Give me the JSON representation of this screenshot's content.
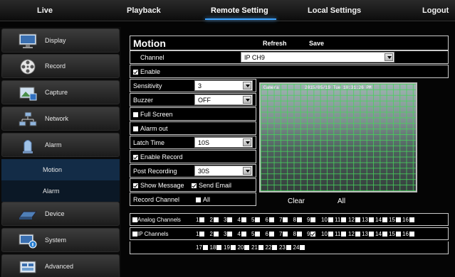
{
  "topnav": {
    "tabs": [
      {
        "label": "Live"
      },
      {
        "label": "Playback"
      },
      {
        "label": "Remote Setting"
      },
      {
        "label": "Local Settings"
      },
      {
        "label": "Logout"
      }
    ],
    "active_tab": "Remote Setting",
    "accent_color": "#3fa4ff"
  },
  "sidebar": {
    "items": [
      {
        "label": "Display",
        "icon": "monitor-icon"
      },
      {
        "label": "Record",
        "icon": "film-reel-icon"
      },
      {
        "label": "Capture",
        "icon": "capture-image-icon"
      },
      {
        "label": "Network",
        "icon": "network-icon"
      },
      {
        "label": "Alarm",
        "icon": "alarm-icon"
      },
      {
        "label": "Device",
        "icon": "hard-drive-icon"
      },
      {
        "label": "System",
        "icon": "system-info-icon"
      },
      {
        "label": "Advanced",
        "icon": "advanced-settings-icon"
      }
    ],
    "alarm_subitems": [
      {
        "label": "Motion",
        "selected": true
      },
      {
        "label": "Alarm",
        "selected": false
      }
    ]
  },
  "panel": {
    "title": "Motion",
    "refresh_label": "Refresh",
    "save_label": "Save",
    "channel_label": "Channel",
    "channel_value": "IP CH9",
    "enable_label": "Enable",
    "enable_checked": true,
    "sensitivity_label": "Sensitivity",
    "sensitivity_value": "3",
    "buzzer_label": "Buzzer",
    "buzzer_value": "OFF",
    "full_screen_label": "Full Screen",
    "full_screen_checked": false,
    "alarm_out_label": "Alarm out",
    "alarm_out_checked": false,
    "latch_time_label": "Latch Time",
    "latch_time_value": "10S",
    "enable_record_label": "Enable Record",
    "enable_record_checked": true,
    "post_recording_label": "Post Recording",
    "post_recording_value": "30S",
    "show_message_label": "Show Message",
    "show_message_checked": true,
    "send_email_label": "Send Email",
    "send_email_checked": true,
    "record_channel_label": "Record Channel",
    "all_label": "All",
    "all_checked": false,
    "clear_label": "Clear",
    "all_button_label": "All",
    "preview_osd_left": "Camera",
    "preview_osd_time": "2015/05/19 Tue 10:31:26 PM"
  },
  "channels": {
    "analog_label": "Analog Channels",
    "analog": [
      {
        "n": "1",
        "on": false
      },
      {
        "n": "2",
        "on": false
      },
      {
        "n": "3",
        "on": false
      },
      {
        "n": "4",
        "on": false
      },
      {
        "n": "5",
        "on": false
      },
      {
        "n": "6",
        "on": false
      },
      {
        "n": "7",
        "on": false
      },
      {
        "n": "8",
        "on": false
      },
      {
        "n": "9",
        "on": false
      },
      {
        "n": "10",
        "on": false
      },
      {
        "n": "11",
        "on": false
      },
      {
        "n": "12",
        "on": false
      },
      {
        "n": "13",
        "on": false
      },
      {
        "n": "14",
        "on": false
      },
      {
        "n": "15",
        "on": false
      },
      {
        "n": "16",
        "on": false
      }
    ],
    "ip_label": "IP Channels",
    "ip": [
      {
        "n": "1",
        "on": false
      },
      {
        "n": "2",
        "on": false
      },
      {
        "n": "3",
        "on": false
      },
      {
        "n": "4",
        "on": false
      },
      {
        "n": "5",
        "on": false
      },
      {
        "n": "6",
        "on": false
      },
      {
        "n": "7",
        "on": false
      },
      {
        "n": "8",
        "on": false
      },
      {
        "n": "9",
        "on": true
      },
      {
        "n": "10",
        "on": false
      },
      {
        "n": "11",
        "on": false
      },
      {
        "n": "12",
        "on": false
      },
      {
        "n": "13",
        "on": false
      },
      {
        "n": "14",
        "on": false
      },
      {
        "n": "15",
        "on": false
      },
      {
        "n": "16",
        "on": false
      },
      {
        "n": "17",
        "on": false
      },
      {
        "n": "18",
        "on": false
      },
      {
        "n": "19",
        "on": false
      },
      {
        "n": "20",
        "on": false
      },
      {
        "n": "21",
        "on": false
      },
      {
        "n": "22",
        "on": false
      },
      {
        "n": "23",
        "on": false
      },
      {
        "n": "24",
        "on": false
      }
    ]
  }
}
